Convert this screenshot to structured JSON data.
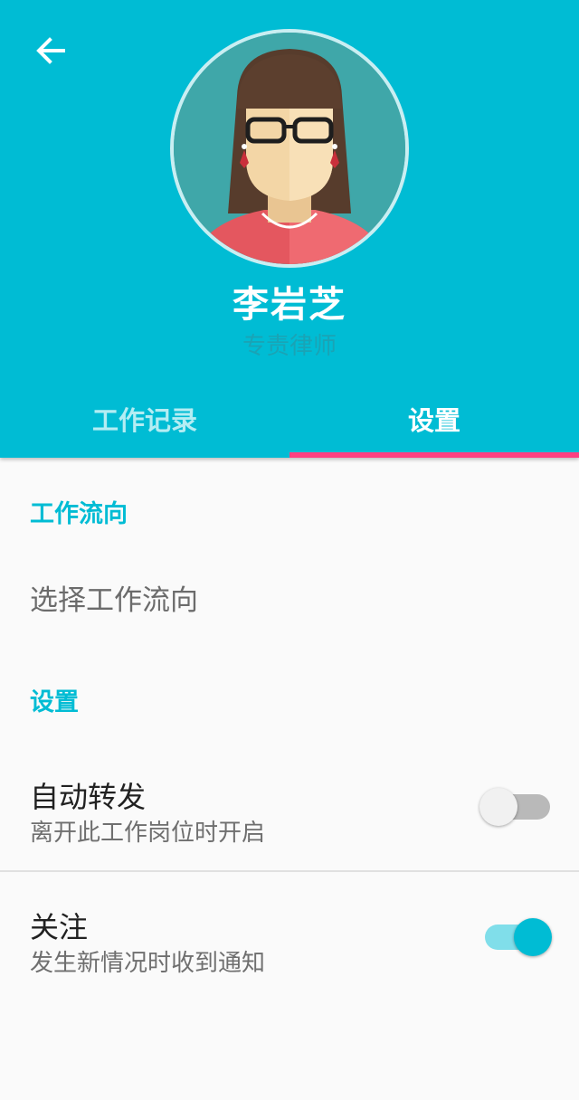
{
  "header": {
    "back_icon": "arrow-left-icon",
    "avatar_icon": "woman-avatar-icon",
    "name": "李岩芝",
    "role": "专责律师",
    "bg_color": "#00bcd4"
  },
  "tabs": [
    {
      "label": "工作记录",
      "selected": false
    },
    {
      "label": "设置",
      "selected": true
    }
  ],
  "tab_indicator_color": "#ff4081",
  "sections": {
    "workflow": {
      "title": "工作流向",
      "item_label": "选择工作流向"
    },
    "settings": {
      "title": "设置",
      "auto_forward": {
        "title": "自动转发",
        "summary": "离开此工作岗位时开启",
        "enabled": false
      },
      "follow": {
        "title": "关注",
        "summary": "发生新情况时收到通知",
        "enabled": true
      }
    }
  }
}
